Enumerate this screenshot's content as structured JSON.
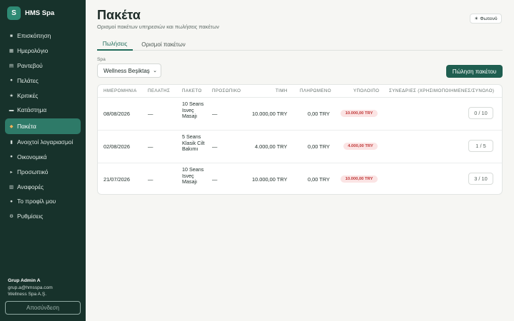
{
  "brand": {
    "logo_letter": "S",
    "name": "HMS Spa"
  },
  "sidebar": {
    "items": [
      {
        "icon": "■",
        "icon_name": "overview-icon",
        "label": "Επισκόπηση"
      },
      {
        "icon": "▦",
        "icon_name": "calendar-icon",
        "label": "Ημερολόγιο"
      },
      {
        "icon": "▤",
        "icon_name": "appointments-icon",
        "label": "Ραντεβού"
      },
      {
        "icon": "●",
        "icon_name": "customers-icon",
        "label": "Πελάτες"
      },
      {
        "icon": "★",
        "icon_name": "star-icon",
        "label": "Κριτικές"
      },
      {
        "icon": "▬",
        "icon_name": "store-icon",
        "label": "Κατάστημα"
      },
      {
        "icon": "◆",
        "icon_name": "gift-icon",
        "label": "Πακέτα"
      },
      {
        "icon": "▮",
        "icon_name": "receipt-icon",
        "label": "Ανοιχτοί λογαριασμοί"
      },
      {
        "icon": "●",
        "icon_name": "money-bag-icon",
        "label": "Οικονομικά"
      },
      {
        "icon": "▸",
        "icon_name": "flag-icon",
        "label": "Προσωπικό"
      },
      {
        "icon": "▥",
        "icon_name": "reports-icon",
        "label": "Αναφορές"
      },
      {
        "icon": "●",
        "icon_name": "user-icon",
        "label": "Το προφίλ μου"
      },
      {
        "icon": "⚙",
        "icon_name": "gear-icon",
        "label": "Ρυθμίσεις"
      }
    ],
    "active_index": 6
  },
  "user": {
    "name": "Grup Admin A",
    "email": "grup.a@hmsspa.com",
    "company": "Wellness Spa A.Ş."
  },
  "logout_label": "Αποσύνδεση",
  "page": {
    "title": "Πακέτα",
    "subtitle": "Ορισμοί πακέτων υπηρεσιών και πωλήσεις πακέτων"
  },
  "theme_toggle": {
    "icon": "☀",
    "label": "Φωτεινό"
  },
  "tabs": [
    "Πωλήσεις",
    "Ορισμοί πακέτων"
  ],
  "spa_filter": {
    "label": "Spa",
    "selected": "Wellness Beşiktaş"
  },
  "sell_button": "Πώληση πακέτου",
  "table": {
    "headers": [
      "ΗΜΕΡΟΜΗΝΙΑ",
      "ΠΕΛΑΤΗΣ",
      "ΠΑΚΕΤΟ",
      "ΠΡΟΣΩΠΙΚΟ",
      "ΤΙΜΗ",
      "ΠΛΗΡΩΜΕΝΟ",
      "ΥΠΟΛΟΙΠΟ",
      "ΣΥΝΕΔΡΙΕΣ (ΧΡΗΣΙΜΟΠΟΙΗΜΕΝΕΣ/ΣΥΝΟΛΟ)"
    ],
    "rows": [
      {
        "date": "08/08/2026",
        "customer": "—",
        "package": "10 Seans Isveç Masajı",
        "staff": "—",
        "price": "10.000,00 TRY",
        "paid": "0,00 TRY",
        "balance": "10.000,00 TRY",
        "sessions": "0 / 10"
      },
      {
        "date": "02/08/2026",
        "customer": "—",
        "package": "5 Seans Klasik Cilt Bakımı",
        "staff": "—",
        "price": "4.000,00 TRY",
        "paid": "0,00 TRY",
        "balance": "4.000,00 TRY",
        "sessions": "1 / 5"
      },
      {
        "date": "21/07/2026",
        "customer": "—",
        "package": "10 Seans Isveç Masajı",
        "staff": "—",
        "price": "10.000,00 TRY",
        "paid": "0,00 TRY",
        "balance": "10.000,00 TRY",
        "sessions": "3 / 10"
      }
    ]
  },
  "colors": {
    "sidebar_bg": "#17322b",
    "accent": "#1f5e50",
    "active_nav": "#2e7a68",
    "badge_bg": "#fbe4e4",
    "badge_text": "#c03a3a"
  }
}
